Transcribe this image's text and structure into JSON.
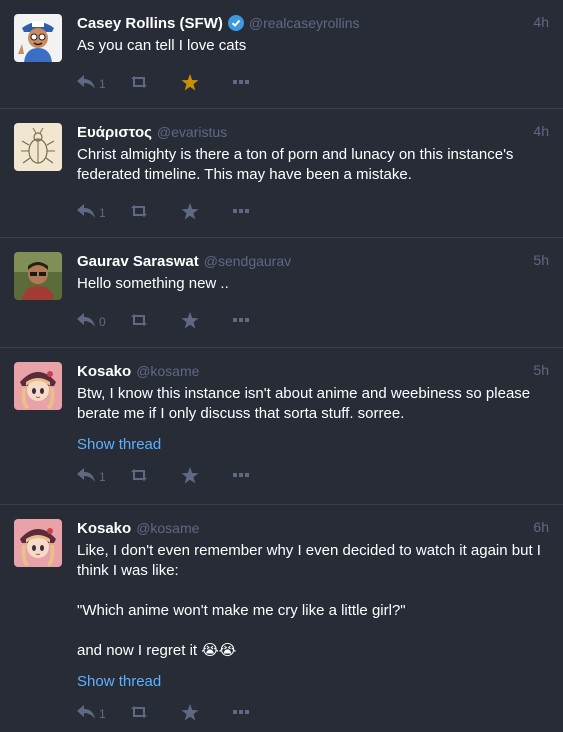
{
  "statuses": [
    {
      "display_name": "Casey Rollins (SFW)",
      "verified": true,
      "acct": "@realcaseyrollins",
      "time": "4h",
      "paragraphs": [
        "As you can tell I love cats"
      ],
      "show_thread": "",
      "replies": "1",
      "favourited": true,
      "avatar": "cartoon-avatar"
    },
    {
      "display_name": "Ευάριστος",
      "verified": false,
      "acct": "@evaristus",
      "time": "4h",
      "paragraphs": [
        "Christ almighty is there a ton of porn and lunacy on this instance's federated timeline. This may have been a mistake."
      ],
      "show_thread": "",
      "replies": "1",
      "favourited": false,
      "avatar": "beetle-sketch-avatar"
    },
    {
      "display_name": "Gaurav Saraswat",
      "verified": false,
      "acct": "@sendgaurav",
      "time": "5h",
      "paragraphs": [
        "Hello something new .."
      ],
      "show_thread": "",
      "replies": "0",
      "favourited": false,
      "avatar": "photo-avatar"
    },
    {
      "display_name": "Kosako",
      "verified": false,
      "acct": "@kosame",
      "time": "5h",
      "paragraphs": [
        "Btw, I know this instance isn't about anime and weebiness so please berate me if I only discuss that sorta stuff. sorree."
      ],
      "show_thread": "Show thread",
      "replies": "1",
      "favourited": false,
      "avatar": "anime-avatar"
    },
    {
      "display_name": "Kosako",
      "verified": false,
      "acct": "@kosame",
      "time": "6h",
      "paragraphs": [
        "Like, I don't even remember why I even decided to watch it again but I think I was like:",
        "\"Which anime won't make me cry like a little girl?\"",
        "and now I regret it 😭😭"
      ],
      "show_thread": "Show thread",
      "replies": "1",
      "favourited": false,
      "avatar": "anime-avatar"
    }
  ],
  "colors": {
    "background": "#282c37",
    "muted": "#606984",
    "link": "#5cb1ff",
    "favourite": "#ca8f04",
    "verified": "#3c99dc"
  }
}
